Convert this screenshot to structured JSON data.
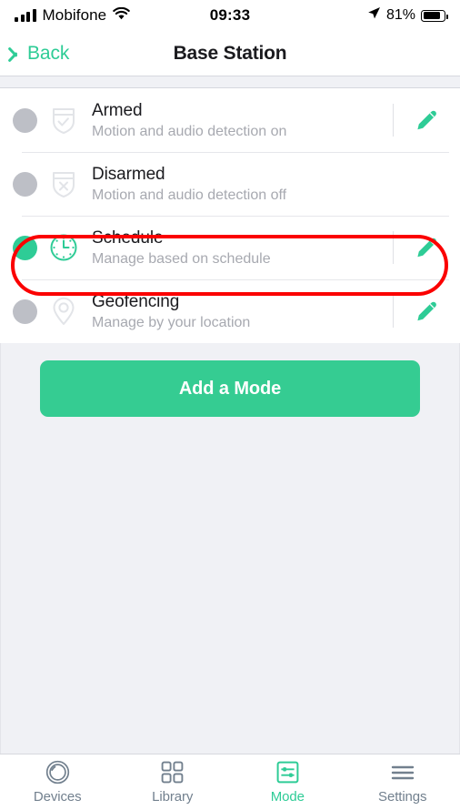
{
  "status_bar": {
    "carrier": "Mobifone",
    "signal_icon": "signal-bars-icon",
    "wifi_icon": "wifi-icon",
    "time": "09:33",
    "location_icon": "location-arrow-icon",
    "battery_percent": "81%",
    "battery_icon": "battery-icon"
  },
  "header": {
    "back_label": "Back",
    "back_icon": "chevron-left-icon",
    "title": "Base Station"
  },
  "colors": {
    "accent_green": "#2ecc96",
    "button_green": "#35cc92",
    "annotation_red": "#fb0000",
    "inactive_gray": "#bdbfc6",
    "background": "#f0f1f5"
  },
  "modes": [
    {
      "id": "armed",
      "title": "Armed",
      "subtitle": "Motion and audio detection on",
      "icon": "shield-check-icon",
      "selected": false,
      "has_edit": true
    },
    {
      "id": "disarmed",
      "title": "Disarmed",
      "subtitle": "Motion and audio detection off",
      "icon": "shield-x-icon",
      "selected": false,
      "has_edit": false
    },
    {
      "id": "schedule",
      "title": "Schedule",
      "subtitle": "Manage based on schedule",
      "icon": "clock-icon",
      "selected": true,
      "has_edit": true,
      "highlighted": true
    },
    {
      "id": "geofencing",
      "title": "Geofencing",
      "subtitle": "Manage by your location",
      "icon": "map-pin-icon",
      "selected": false,
      "has_edit": true
    }
  ],
  "edit_icon": "pencil-icon",
  "add_button": {
    "label": "Add a Mode"
  },
  "tabs": [
    {
      "id": "devices",
      "label": "Devices",
      "icon": "camera-lens-icon",
      "active": false
    },
    {
      "id": "library",
      "label": "Library",
      "icon": "grid-icon",
      "active": false
    },
    {
      "id": "mode",
      "label": "Mode",
      "icon": "sliders-icon",
      "active": true
    },
    {
      "id": "settings",
      "label": "Settings",
      "icon": "hamburger-icon",
      "active": false
    }
  ]
}
